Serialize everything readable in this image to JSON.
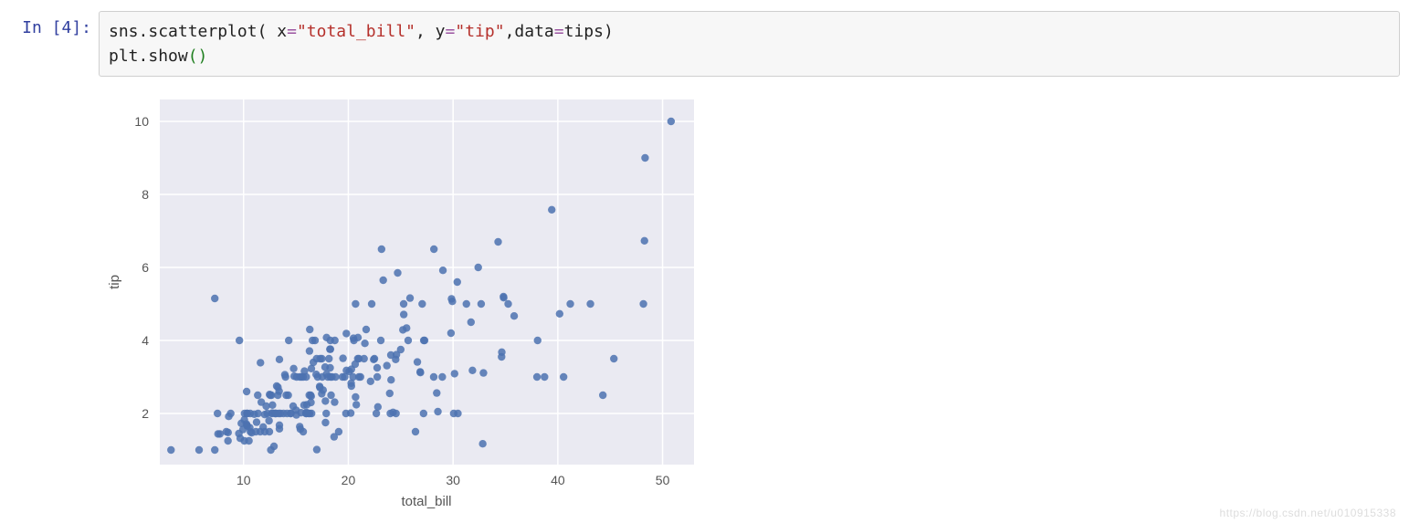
{
  "cell": {
    "prompt_in": "In ",
    "prompt_num": "[4]:",
    "code": {
      "t1": "sns",
      "t2": ".",
      "t3": "scatterplot",
      "t4": "(",
      "t5": " x",
      "t6": "=",
      "t7": "\"total_bill\"",
      "t8": ",",
      "t9": " y",
      "t10": "=",
      "t11": "\"tip\"",
      "t12": ",",
      "t13": "data",
      "t14": "=",
      "t15": "tips",
      "t16": ")",
      "line2_1": "plt",
      "line2_2": ".",
      "line2_3": "show",
      "line2_4": "()"
    }
  },
  "watermark": "https://blog.csdn.net/u010915338",
  "chart_data": {
    "type": "scatter",
    "xlabel": "total_bill",
    "ylabel": "tip",
    "xlim": [
      2,
      53
    ],
    "ylim": [
      0.6,
      10.6
    ],
    "xticks": [
      10,
      20,
      30,
      40,
      50
    ],
    "yticks": [
      2,
      4,
      6,
      8,
      10
    ],
    "series": [
      {
        "name": "tips",
        "points": [
          [
            3.07,
            1.0
          ],
          [
            5.75,
            1.0
          ],
          [
            7.25,
            1.0
          ],
          [
            7.25,
            5.15
          ],
          [
            7.51,
            2.0
          ],
          [
            7.56,
            1.44
          ],
          [
            7.74,
            1.44
          ],
          [
            8.35,
            1.5
          ],
          [
            8.51,
            1.25
          ],
          [
            8.52,
            1.48
          ],
          [
            8.58,
            1.92
          ],
          [
            8.77,
            2.0
          ],
          [
            9.55,
            1.45
          ],
          [
            9.6,
            4.0
          ],
          [
            9.68,
            1.32
          ],
          [
            9.78,
            1.73
          ],
          [
            9.94,
            1.56
          ],
          [
            10.07,
            1.25
          ],
          [
            10.07,
            1.83
          ],
          [
            10.09,
            2.0
          ],
          [
            10.27,
            1.71
          ],
          [
            10.29,
            2.6
          ],
          [
            10.33,
            1.67
          ],
          [
            10.33,
            2.0
          ],
          [
            10.34,
            1.66
          ],
          [
            10.34,
            2.0
          ],
          [
            10.51,
            1.25
          ],
          [
            10.59,
            1.61
          ],
          [
            10.63,
            2.0
          ],
          [
            10.65,
            1.5
          ],
          [
            10.77,
            1.47
          ],
          [
            11.02,
            1.98
          ],
          [
            11.17,
            1.5
          ],
          [
            11.24,
            1.76
          ],
          [
            11.35,
            2.5
          ],
          [
            11.38,
            2.0
          ],
          [
            11.59,
            1.5
          ],
          [
            11.61,
            3.39
          ],
          [
            11.69,
            2.31
          ],
          [
            11.87,
            1.63
          ],
          [
            12.02,
            1.97
          ],
          [
            12.03,
            1.5
          ],
          [
            12.16,
            2.2
          ],
          [
            12.26,
            2.0
          ],
          [
            12.43,
            1.8
          ],
          [
            12.46,
            1.5
          ],
          [
            12.48,
            2.52
          ],
          [
            12.54,
            2.5
          ],
          [
            12.6,
            1.0
          ],
          [
            12.66,
            2.5
          ],
          [
            12.69,
            2.0
          ],
          [
            12.74,
            2.01
          ],
          [
            12.76,
            2.23
          ],
          [
            12.9,
            1.1
          ],
          [
            13.0,
            2.0
          ],
          [
            13.03,
            2.0
          ],
          [
            13.13,
            2.0
          ],
          [
            13.16,
            2.75
          ],
          [
            13.27,
            2.5
          ],
          [
            13.28,
            2.72
          ],
          [
            13.37,
            2.0
          ],
          [
            13.39,
            2.61
          ],
          [
            13.42,
            1.58
          ],
          [
            13.42,
            1.68
          ],
          [
            13.42,
            3.48
          ],
          [
            13.51,
            2.0
          ],
          [
            13.81,
            2.0
          ],
          [
            13.94,
            3.06
          ],
          [
            14.0,
            3.0
          ],
          [
            14.07,
            2.5
          ],
          [
            14.15,
            2.0
          ],
          [
            14.26,
            2.5
          ],
          [
            14.31,
            4.0
          ],
          [
            14.48,
            2.0
          ],
          [
            14.52,
            2.0
          ],
          [
            14.73,
            2.2
          ],
          [
            14.78,
            3.23
          ],
          [
            14.83,
            3.02
          ],
          [
            15.01,
            2.09
          ],
          [
            15.04,
            1.96
          ],
          [
            15.06,
            3.0
          ],
          [
            15.36,
            1.64
          ],
          [
            15.38,
            3.0
          ],
          [
            15.42,
            1.57
          ],
          [
            15.48,
            2.02
          ],
          [
            15.53,
            3.0
          ],
          [
            15.69,
            1.5
          ],
          [
            15.69,
            3.0
          ],
          [
            15.77,
            2.23
          ],
          [
            15.81,
            3.16
          ],
          [
            15.95,
            2.0
          ],
          [
            15.98,
            2.03
          ],
          [
            15.98,
            3.0
          ],
          [
            16.0,
            2.0
          ],
          [
            16.04,
            2.24
          ],
          [
            16.21,
            2.0
          ],
          [
            16.27,
            2.5
          ],
          [
            16.29,
            3.71
          ],
          [
            16.31,
            2.0
          ],
          [
            16.32,
            4.3
          ],
          [
            16.4,
            2.5
          ],
          [
            16.43,
            2.3
          ],
          [
            16.45,
            2.47
          ],
          [
            16.47,
            3.23
          ],
          [
            16.49,
            2.0
          ],
          [
            16.58,
            4.0
          ],
          [
            16.66,
            3.4
          ],
          [
            16.82,
            4.0
          ],
          [
            16.93,
            3.07
          ],
          [
            16.97,
            3.5
          ],
          [
            16.99,
            1.01
          ],
          [
            17.07,
            3.0
          ],
          [
            17.26,
            2.74
          ],
          [
            17.29,
            2.71
          ],
          [
            17.31,
            3.5
          ],
          [
            17.46,
            2.54
          ],
          [
            17.47,
            3.5
          ],
          [
            17.51,
            3.0
          ],
          [
            17.59,
            2.64
          ],
          [
            17.78,
            3.27
          ],
          [
            17.81,
            2.34
          ],
          [
            17.82,
            1.75
          ],
          [
            17.89,
            2.0
          ],
          [
            17.92,
            3.08
          ],
          [
            17.92,
            4.08
          ],
          [
            18.04,
            3.0
          ],
          [
            18.15,
            3.5
          ],
          [
            18.24,
            3.76
          ],
          [
            18.26,
            3.25
          ],
          [
            18.28,
            4.0
          ],
          [
            18.29,
            3.0
          ],
          [
            18.29,
            3.76
          ],
          [
            18.35,
            2.5
          ],
          [
            18.43,
            3.0
          ],
          [
            18.64,
            1.36
          ],
          [
            18.69,
            2.31
          ],
          [
            18.71,
            4.0
          ],
          [
            18.78,
            3.0
          ],
          [
            19.08,
            1.5
          ],
          [
            19.44,
            3.0
          ],
          [
            19.49,
            3.51
          ],
          [
            19.65,
            3.0
          ],
          [
            19.77,
            2.0
          ],
          [
            19.81,
            4.19
          ],
          [
            19.82,
            3.18
          ],
          [
            20.08,
            3.15
          ],
          [
            20.23,
            2.01
          ],
          [
            20.27,
            2.83
          ],
          [
            20.29,
            2.75
          ],
          [
            20.29,
            3.21
          ],
          [
            20.45,
            3.0
          ],
          [
            20.49,
            4.06
          ],
          [
            20.53,
            4.0
          ],
          [
            20.65,
            3.35
          ],
          [
            20.69,
            2.45
          ],
          [
            20.69,
            5.0
          ],
          [
            20.76,
            2.24
          ],
          [
            20.9,
            3.5
          ],
          [
            20.92,
            4.08
          ],
          [
            21.01,
            3.0
          ],
          [
            21.01,
            3.5
          ],
          [
            21.16,
            3.0
          ],
          [
            21.5,
            3.5
          ],
          [
            21.58,
            3.92
          ],
          [
            21.7,
            4.3
          ],
          [
            22.12,
            2.88
          ],
          [
            22.23,
            5.0
          ],
          [
            22.42,
            3.48
          ],
          [
            22.49,
            3.5
          ],
          [
            22.67,
            2.0
          ],
          [
            22.75,
            3.25
          ],
          [
            22.76,
            3.0
          ],
          [
            22.82,
            2.18
          ],
          [
            23.1,
            4.0
          ],
          [
            23.17,
            6.5
          ],
          [
            23.33,
            5.65
          ],
          [
            23.68,
            3.31
          ],
          [
            23.95,
            2.55
          ],
          [
            24.01,
            2.0
          ],
          [
            24.06,
            3.6
          ],
          [
            24.08,
            2.92
          ],
          [
            24.27,
            2.03
          ],
          [
            24.52,
            3.48
          ],
          [
            24.55,
            2.0
          ],
          [
            24.59,
            3.61
          ],
          [
            24.71,
            5.85
          ],
          [
            25.0,
            3.75
          ],
          [
            25.21,
            4.29
          ],
          [
            25.28,
            5.0
          ],
          [
            25.29,
            4.71
          ],
          [
            25.56,
            4.34
          ],
          [
            25.71,
            4.0
          ],
          [
            25.89,
            5.16
          ],
          [
            26.41,
            1.5
          ],
          [
            26.59,
            3.41
          ],
          [
            26.86,
            3.14
          ],
          [
            26.88,
            3.12
          ],
          [
            27.05,
            5.0
          ],
          [
            27.18,
            2.0
          ],
          [
            27.2,
            4.0
          ],
          [
            27.28,
            4.0
          ],
          [
            28.15,
            3.0
          ],
          [
            28.17,
            6.5
          ],
          [
            28.44,
            2.56
          ],
          [
            28.55,
            2.05
          ],
          [
            28.97,
            3.0
          ],
          [
            29.03,
            5.92
          ],
          [
            29.8,
            4.2
          ],
          [
            29.85,
            5.14
          ],
          [
            29.93,
            5.07
          ],
          [
            30.06,
            2.0
          ],
          [
            30.14,
            3.09
          ],
          [
            30.4,
            5.6
          ],
          [
            30.46,
            2.0
          ],
          [
            31.27,
            5.0
          ],
          [
            31.71,
            4.5
          ],
          [
            31.85,
            3.18
          ],
          [
            32.4,
            6.0
          ],
          [
            32.68,
            5.0
          ],
          [
            32.83,
            1.17
          ],
          [
            32.9,
            3.11
          ],
          [
            34.3,
            6.7
          ],
          [
            34.63,
            3.55
          ],
          [
            34.65,
            3.68
          ],
          [
            34.81,
            5.2
          ],
          [
            34.83,
            5.17
          ],
          [
            35.26,
            5.0
          ],
          [
            35.83,
            4.67
          ],
          [
            38.01,
            3.0
          ],
          [
            38.07,
            4.0
          ],
          [
            38.73,
            3.0
          ],
          [
            39.42,
            7.58
          ],
          [
            40.17,
            4.73
          ],
          [
            40.55,
            3.0
          ],
          [
            41.19,
            5.0
          ],
          [
            43.11,
            5.0
          ],
          [
            44.3,
            2.5
          ],
          [
            45.35,
            3.5
          ],
          [
            48.17,
            5.0
          ],
          [
            48.27,
            6.73
          ],
          [
            48.33,
            9.0
          ],
          [
            50.81,
            10.0
          ]
        ]
      }
    ]
  }
}
